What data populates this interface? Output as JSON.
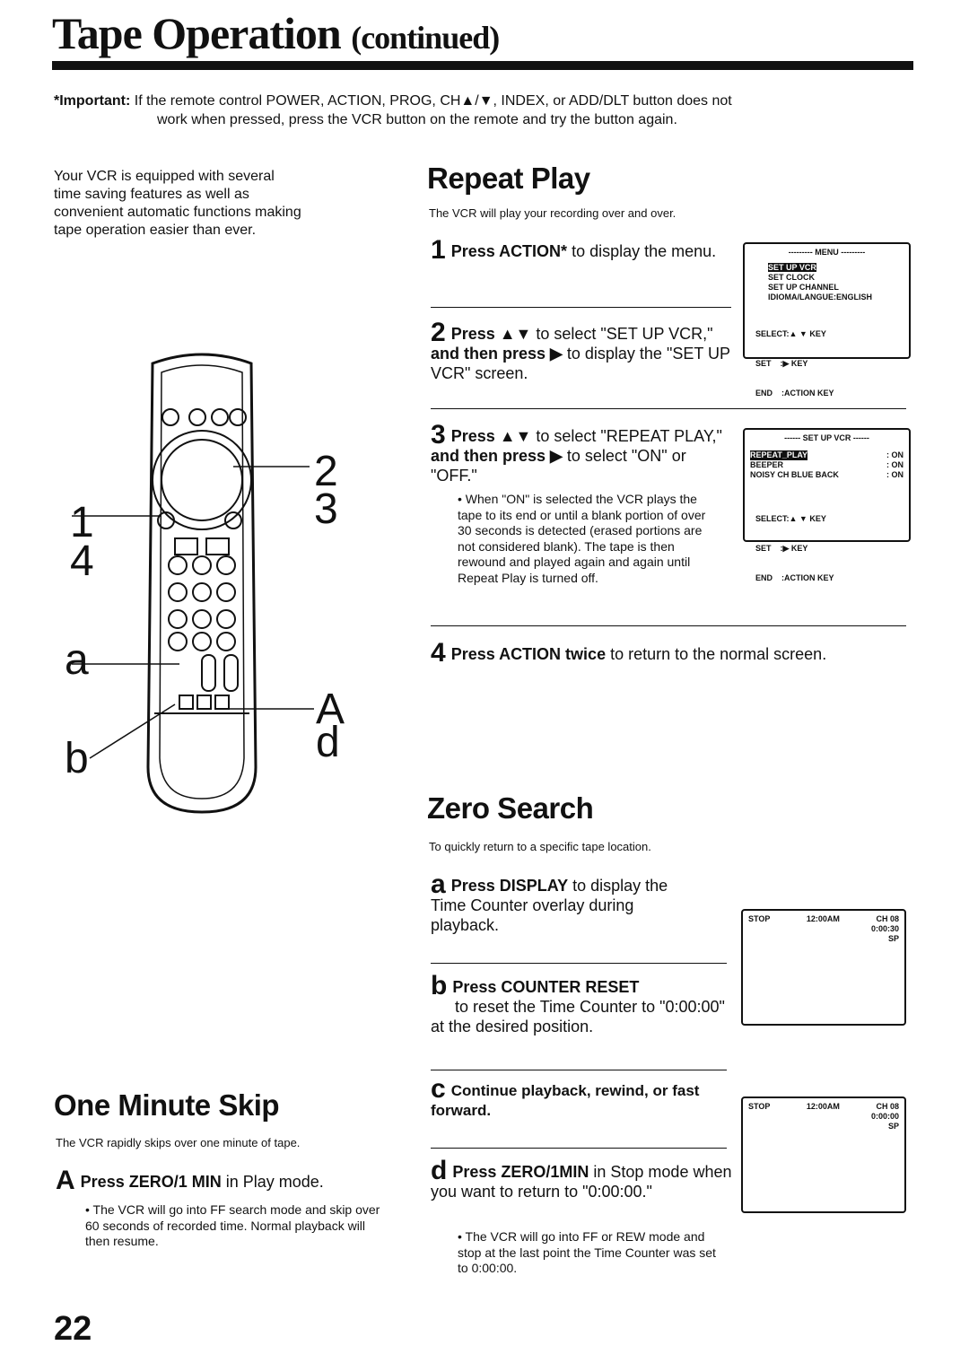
{
  "header": {
    "title": "Tape Operation",
    "title_suffix": "(continued)"
  },
  "important": {
    "label": "*Important:",
    "line1": "If the remote control POWER, ACTION, PROG, CH▲/▼, INDEX, or ADD/DLT button does not",
    "line2": "work when pressed, press the VCR button on the remote and try the button again."
  },
  "intro": "Your VCR is equipped with several time saving features as well as convenient automatic functions making tape operation easier than ever.",
  "remote_callouts": {
    "l1": "1",
    "l4": "4",
    "la": "a",
    "lb": "b",
    "r2": "2",
    "r3": "3",
    "rA": "A",
    "rd": "d"
  },
  "repeat": {
    "title": "Repeat Play",
    "subtitle": "The VCR will play your recording over and over.",
    "s1": {
      "num": "1",
      "b1": "Press ACTION*",
      "t1": " to display the menu."
    },
    "s2": {
      "num": "2",
      "b1": "Press ▲▼",
      "t1": " to select \"SET UP VCR,\" ",
      "b2": "and then press ▶",
      "t2": " to display the \"SET UP VCR\" screen."
    },
    "s3": {
      "num": "3",
      "b1": "Press ▲▼",
      "t1": " to select \"REPEAT PLAY,\" ",
      "b2": "and then press ▶",
      "t2": " to select \"ON\" or \"OFF.\"",
      "bullet": "When \"ON\" is selected the VCR plays the tape to its end or until a blank portion of over 30 seconds is detected (erased portions are not considered blank). The tape is then rewound and played again and again until Repeat Play is turned off."
    },
    "s4": {
      "num": "4",
      "b1": "Press ACTION twice",
      "t1": " to return to the normal screen."
    },
    "menu_screen": {
      "header": "--------- MENU ---------",
      "items": [
        "SET UP VCR",
        "SET CLOCK",
        "SET UP CHANNEL",
        "IDIOMA/LANGUE:ENGLISH"
      ],
      "keys": [
        "SELECT:▲ ▼ KEY",
        "SET    :▶ KEY",
        "END    :ACTION KEY"
      ]
    },
    "setup_screen": {
      "header": "------ SET UP VCR ------",
      "items": [
        {
          "label": "REPEAT_PLAY",
          "value": ": ON"
        },
        {
          "label": "BEEPER",
          "value": ": ON"
        },
        {
          "label": "NOISY CH BLUE BACK",
          "value": ": ON"
        }
      ],
      "keys": [
        "SELECT:▲ ▼ KEY",
        "SET    :▶ KEY",
        "END    :ACTION KEY"
      ]
    }
  },
  "zero": {
    "title": "Zero Search",
    "subtitle": "To quickly return to a specific tape location.",
    "sa": {
      "num": "a",
      "b1": "Press DISPLAY",
      "t1": " to display the Time Counter overlay during playback."
    },
    "sb": {
      "num": "b",
      "b1": "Press COUNTER RESET",
      "t1": "to reset the Time Counter to \"0:00:00\" at the desired position."
    },
    "sc": {
      "num": "c",
      "b1": "Continue playback, rewind, or fast forward."
    },
    "sd": {
      "num": "d",
      "b1": "Press ZERO/1MIN",
      "t1": " in Stop mode when you want to return to \"0:00:00.\"",
      "bullet": "The VCR will go into FF or REW mode and stop at the last point the Time Counter was set to 0:00:00."
    },
    "screen1": {
      "status": "STOP",
      "time": "12:00AM",
      "ch": "CH 08",
      "counter": "0:00:30",
      "speed": "SP"
    },
    "screen2": {
      "status": "STOP",
      "time": "12:00AM",
      "ch": "CH 08",
      "counter": "0:00:00",
      "speed": "SP"
    }
  },
  "skip": {
    "title": "One Minute Skip",
    "subtitle": "The VCR rapidly skips over one minute of tape.",
    "sA": {
      "num": "A",
      "b1": "Press ZERO/1 MIN",
      "t1": " in Play mode.",
      "bullet": "The VCR will go into FF search mode and skip over 60 seconds of recorded time. Normal playback will then resume."
    }
  },
  "page_number": "22"
}
